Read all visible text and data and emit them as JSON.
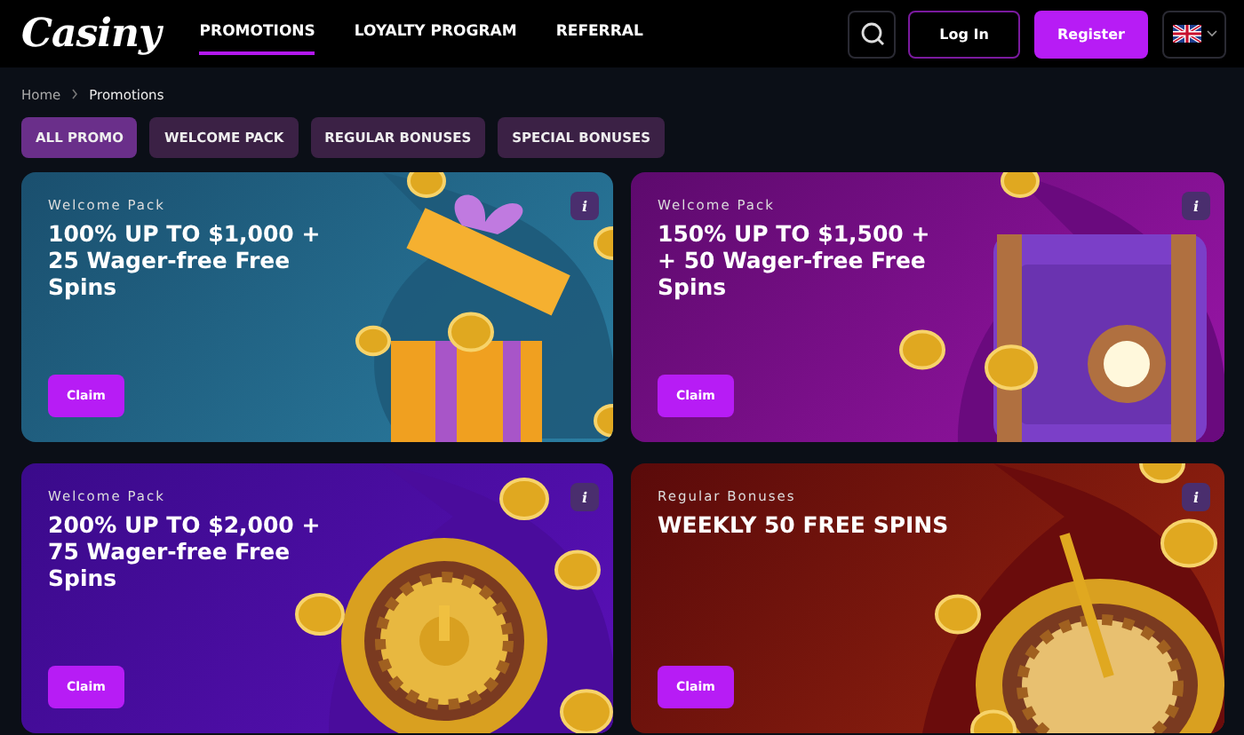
{
  "header": {
    "logo": "Casiny",
    "nav": [
      {
        "label": "PROMOTIONS",
        "selected": true
      },
      {
        "label": "LOYALTY PROGRAM",
        "selected": false
      },
      {
        "label": "REFERRAL",
        "selected": false
      }
    ],
    "login": "Log In",
    "register": "Register"
  },
  "breadcrumb": [
    "Home",
    "Promotions"
  ],
  "filters": [
    {
      "label": "ALL PROMO",
      "selected": true
    },
    {
      "label": "WELCOME PACK",
      "selected": false
    },
    {
      "label": "REGULAR BONUSES",
      "selected": false
    },
    {
      "label": "SPECIAL BONUSES",
      "selected": false
    }
  ],
  "promos": [
    {
      "kind": "gift",
      "category": "Welcome Pack",
      "title": "100% UP TO $1,000 + 25 Wager-free Free Spins",
      "info": "i",
      "button": "Claim"
    },
    {
      "kind": "chest",
      "category": "Welcome Pack",
      "title": "150% UP TO $1,500 + + 50 Wager-free Free Spins",
      "info": "i",
      "button": "Claim"
    },
    {
      "kind": "roulette",
      "category": "Welcome Pack",
      "title": "200% UP TO $2,000 + 75 Wager-free Free Spins",
      "info": "i",
      "button": "Claim"
    },
    {
      "kind": "wheel",
      "category": "Regular Bonuses",
      "title": "WEEKLY 50 FREE SPINS",
      "info": "i",
      "button": "Claim"
    }
  ]
}
